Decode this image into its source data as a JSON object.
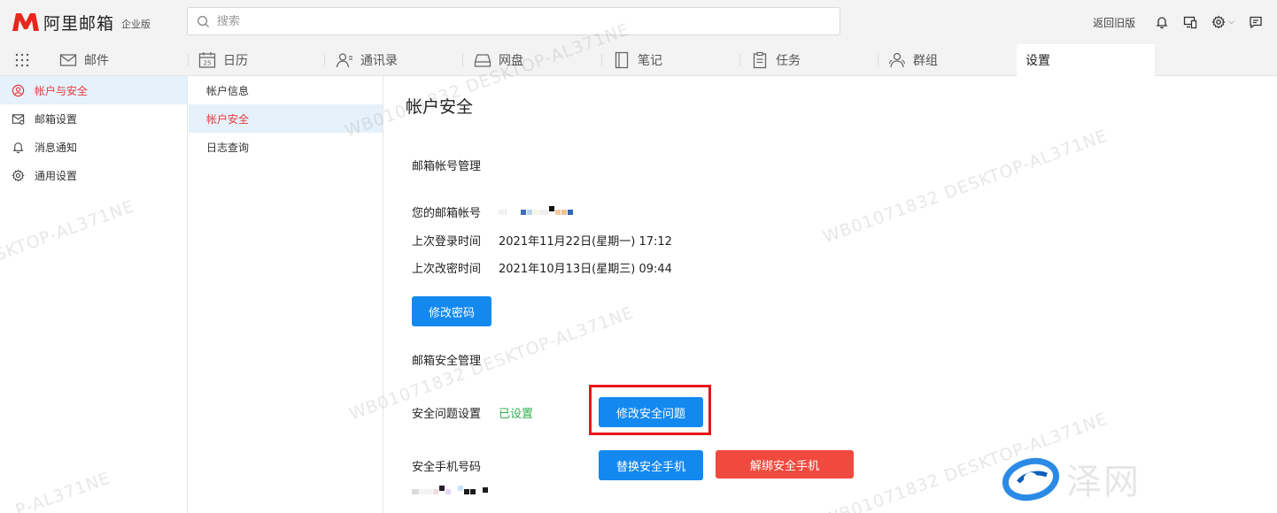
{
  "header": {
    "logo_text": "阿里邮箱",
    "edition": "企业版",
    "search_placeholder": "搜索",
    "back_old": "返回旧版"
  },
  "nav": {
    "tabs": [
      {
        "label": "邮件",
        "icon": "mail-icon"
      },
      {
        "label": "日历",
        "icon": "calendar-icon",
        "badge": "25"
      },
      {
        "label": "通讯录",
        "icon": "contacts-icon"
      },
      {
        "label": "网盘",
        "icon": "drive-icon"
      },
      {
        "label": "笔记",
        "icon": "notes-icon"
      },
      {
        "label": "任务",
        "icon": "tasks-icon"
      },
      {
        "label": "群组",
        "icon": "group-icon"
      },
      {
        "label": "设置",
        "icon": ""
      }
    ]
  },
  "sidebar": {
    "items": [
      {
        "label": "帐户与安全",
        "icon": "user-circle-icon",
        "active": true
      },
      {
        "label": "邮箱设置",
        "icon": "mail-settings-icon"
      },
      {
        "label": "消息通知",
        "icon": "bell-icon"
      },
      {
        "label": "通用设置",
        "icon": "gear-icon"
      }
    ]
  },
  "submenu": {
    "items": [
      {
        "label": "帐户信息"
      },
      {
        "label": "帐户安全",
        "active": true
      },
      {
        "label": "日志查询"
      }
    ]
  },
  "content": {
    "title": "帐户安全",
    "account_mgmt": {
      "heading": "邮箱帐号管理",
      "account_label": "您的邮箱帐号",
      "last_login_label": "上次登录时间",
      "last_login_value": "2021年11月22日(星期一) 17:12",
      "last_pwd_label": "上次改密时间",
      "last_pwd_value": "2021年10月13日(星期三) 09:44",
      "change_password_btn": "修改密码"
    },
    "security_mgmt": {
      "heading": "邮箱安全管理",
      "question_label": "安全问题设置",
      "question_status": "已设置",
      "modify_question_btn": "修改安全问题",
      "phone_label": "安全手机号码",
      "replace_phone_btn": "替换安全手机",
      "unbind_phone_btn": "解绑安全手机"
    }
  },
  "watermark": {
    "full": "WB01071832 DESKTOP-AL371NE",
    "partial_a": "SKTOP-AL371NE",
    "partial_b": "P-AL371NE"
  },
  "brand": {
    "text": "泽网"
  },
  "colors": {
    "accent_blue": "#1389f0",
    "danger_red": "#f04a3e",
    "active_text": "#e8393a",
    "success_green": "#31b350",
    "highlight_border": "#e8161b"
  }
}
